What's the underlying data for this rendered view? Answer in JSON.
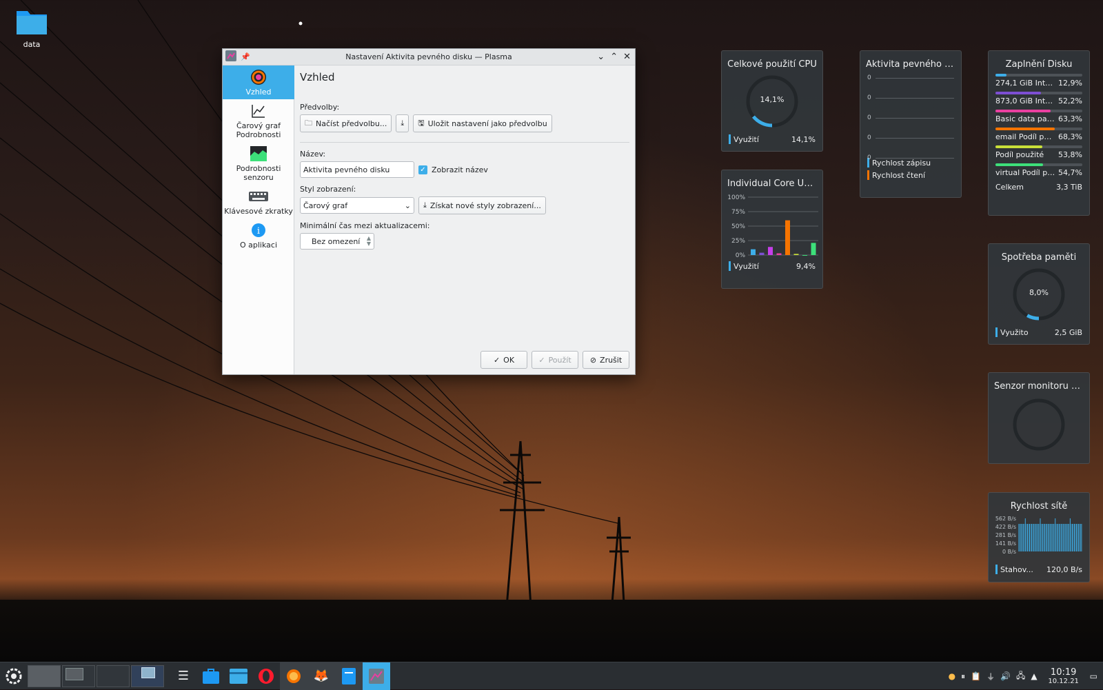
{
  "desktop": {
    "icons": [
      {
        "label": "data",
        "icon": "folder-icon"
      }
    ]
  },
  "dialog": {
    "title": "Nastavení Aktivita pevného disku — Plasma",
    "sidebar": [
      {
        "label": "Vzhled",
        "icon": "appearance-icon",
        "active": true
      },
      {
        "label": "Čarový graf Podrobnosti",
        "icon": "line-chart-icon"
      },
      {
        "label": "Podrobnosti senzoru",
        "icon": "sensor-icon"
      },
      {
        "label": "Klávesové zkratky",
        "icon": "keyboard-icon"
      },
      {
        "label": "O aplikaci",
        "icon": "info-icon"
      }
    ],
    "heading": "Vzhled",
    "presets_label": "Předvolby:",
    "load_preset": "Načíst předvolbu...",
    "save_preset": "Uložit nastavení jako předvolbu",
    "name_label": "Název:",
    "name_value": "Aktivita pevného disku",
    "show_title": "Zobrazit název",
    "style_label": "Styl zobrazení:",
    "style_value": "Čarový graf",
    "get_styles": "Získat nové styly zobrazení...",
    "interval_label": "Minimální čas mezi aktualizacemi:",
    "interval_value": "Bez omezení",
    "ok": "OK",
    "apply": "Použít",
    "cancel": "Zrušit"
  },
  "widgets": {
    "cpu": {
      "title": "Celkové použití CPU",
      "value": "14,1%",
      "fraction": 0.141,
      "legend": "Využití",
      "legend_value": "14,1%"
    },
    "disk_activity": {
      "title": "Aktivita pevného d...",
      "ticks": [
        "0",
        "0",
        "0",
        "0",
        "0"
      ],
      "legend": [
        "Rychlost zápisu",
        "Rychlost čtení"
      ],
      "colors": [
        "#3daee9",
        "#f67400"
      ]
    },
    "disk_fill": {
      "title": "Zaplnění Disku",
      "rows": [
        {
          "label": "274,1 GiB Inter...",
          "value": "12,9%",
          "fraction": 0.129,
          "color": "#3daee9"
        },
        {
          "label": "873,0 GiB Inter...",
          "value": "52,2%",
          "fraction": 0.522,
          "color": "#7d4fd3"
        },
        {
          "label": "Basic data parti...",
          "value": "63,3%",
          "fraction": 0.633,
          "color": "#e93fa0"
        },
        {
          "label": "email Podíl pou...",
          "value": "68,3%",
          "fraction": 0.683,
          "color": "#f67400"
        },
        {
          "label": "Podíl použité",
          "value": "53,8%",
          "fraction": 0.538,
          "color": "#c9e039"
        },
        {
          "label": "virtual Podíl po...",
          "value": "54,7%",
          "fraction": 0.547,
          "color": "#3de07a"
        }
      ],
      "total_label": "Celkem",
      "total_value": "3,3 TiB"
    },
    "cores": {
      "title": "Individual Core Us...",
      "ticks": [
        "100%",
        "75%",
        "50%",
        "25%",
        "0%"
      ],
      "values": [
        10,
        4,
        14,
        3,
        60,
        2,
        0,
        21
      ],
      "colors": [
        "#3daee9",
        "#7d4fd3",
        "#c53fe9",
        "#e93fa0",
        "#f67400",
        "#c9e039",
        "#3de07a",
        "#3de07a"
      ],
      "legend": "Využití",
      "legend_value": "9,4%"
    },
    "memory": {
      "title": "Spotřeba paměti",
      "value": "8,0%",
      "fraction": 0.08,
      "legend": "Využito",
      "legend_value": "2,5 GiB"
    },
    "sensor": {
      "title": "Senzor monitoru s..."
    },
    "network": {
      "title": "Rychlost sítě",
      "ticks": [
        "562 B/s",
        "422 B/s",
        "281 B/s",
        "141 B/s",
        "0 B/s"
      ],
      "legend": "Stahov...",
      "legend_value": "120,0 B/s"
    }
  },
  "taskbar": {
    "time": "10:19",
    "date": "10.12.21"
  }
}
